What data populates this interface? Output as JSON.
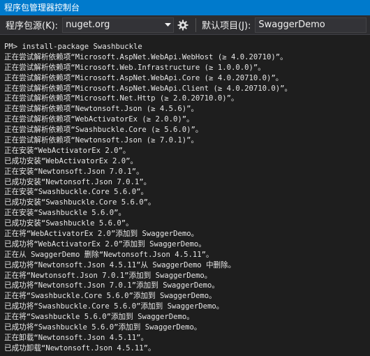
{
  "window": {
    "title": "程序包管理器控制台"
  },
  "toolbar": {
    "source_label": "程序包源(K):",
    "source_value": "nuget.org",
    "default_project_label": "默认项目(J):",
    "default_project_value": "SwaggerDemo",
    "icons": {
      "dropdown": "chevron-down-icon",
      "settings": "gear-icon"
    }
  },
  "console": {
    "lines": [
      "PM> install-package Swashbuckle",
      "正在尝试解析依赖项“Microsoft.AspNet.WebApi.WebHost (≥ 4.0.20710)”。",
      "正在尝试解析依赖项“Microsoft.Web.Infrastructure (≥ 1.0.0.0)”。",
      "正在尝试解析依赖项“Microsoft.AspNet.WebApi.Core (≥ 4.0.20710.0)”。",
      "正在尝试解析依赖项“Microsoft.AspNet.WebApi.Client (≥ 4.0.20710.0)”。",
      "正在尝试解析依赖项“Microsoft.Net.Http (≥ 2.0.20710.0)”。",
      "正在尝试解析依赖项“Newtonsoft.Json (≥ 4.5.6)”。",
      "正在尝试解析依赖项“WebActivatorEx (≥ 2.0.0)”。",
      "正在尝试解析依赖项“Swashbuckle.Core (≥ 5.6.0)”。",
      "正在尝试解析依赖项“Newtonsoft.Json (≥ 7.0.1)”。",
      "正在安装“WebActivatorEx 2.0”。",
      "已成功安装“WebActivatorEx 2.0”。",
      "正在安装“Newtonsoft.Json 7.0.1”。",
      "已成功安装“Newtonsoft.Json 7.0.1”。",
      "正在安装“Swashbuckle.Core 5.6.0”。",
      "已成功安装“Swashbuckle.Core 5.6.0”。",
      "正在安装“Swashbuckle 5.6.0”。",
      "已成功安装“Swashbuckle 5.6.0”。",
      "正在将“WebActivatorEx 2.0”添加到 SwaggerDemo。",
      "已成功将“WebActivatorEx 2.0”添加到 SwaggerDemo。",
      "正在从 SwaggerDemo 删除“Newtonsoft.Json 4.5.11”。",
      "已成功将“Newtonsoft.Json 4.5.11”从 SwaggerDemo 中删除。",
      "正在将“Newtonsoft.Json 7.0.1”添加到 SwaggerDemo。",
      "已成功将“Newtonsoft.Json 7.0.1”添加到 SwaggerDemo。",
      "正在将“Swashbuckle.Core 5.6.0”添加到 SwaggerDemo。",
      "已成功将“Swashbuckle.Core 5.6.0”添加到 SwaggerDemo。",
      "正在将“Swashbuckle 5.6.0”添加到 SwaggerDemo。",
      "已成功将“Swashbuckle 5.6.0”添加到 SwaggerDemo。",
      "正在卸载“Newtonsoft.Json 4.5.11”。",
      "已成功卸载“Newtonsoft.Json 4.5.11”。"
    ]
  }
}
